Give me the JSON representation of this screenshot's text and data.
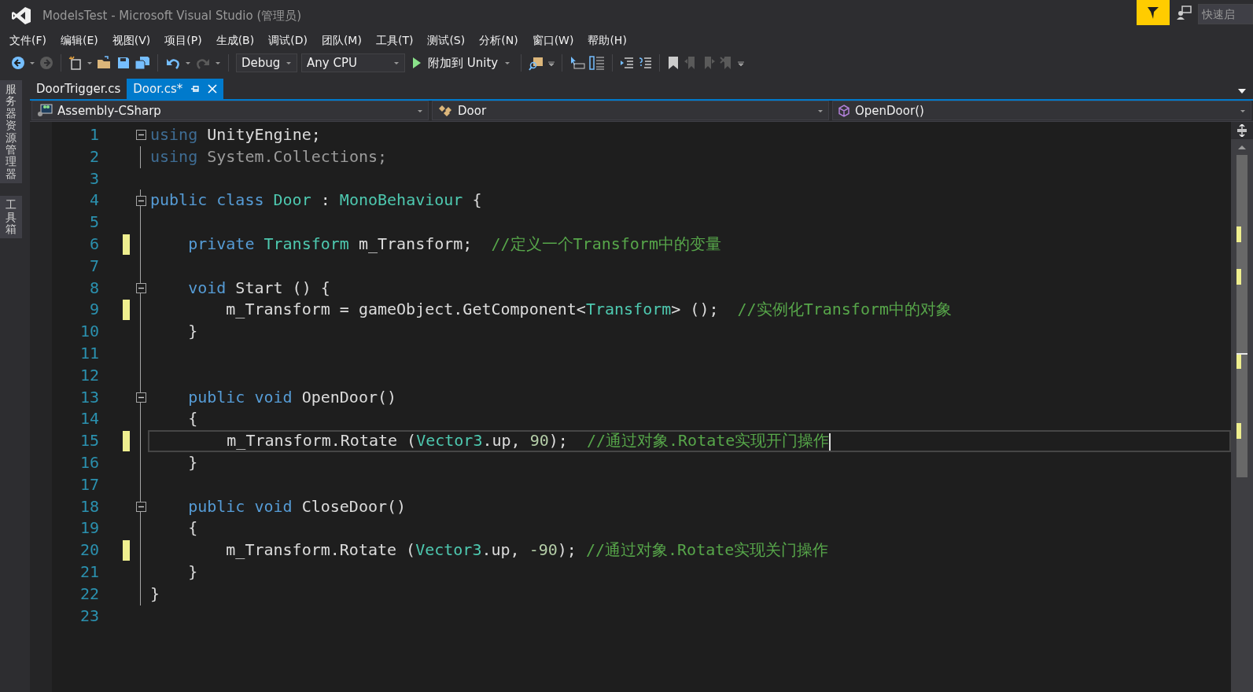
{
  "window": {
    "title": "ModelsTest - Microsoft Visual Studio (管理员)"
  },
  "quick_launch": {
    "placeholder": "快速启"
  },
  "menu": [
    "文件(F)",
    "编辑(E)",
    "视图(V)",
    "项目(P)",
    "生成(B)",
    "调试(D)",
    "团队(M)",
    "工具(T)",
    "测试(S)",
    "分析(N)",
    "窗口(W)",
    "帮助(H)"
  ],
  "toolbar": {
    "configuration": "Debug",
    "platform": "Any CPU",
    "run_label": "附加到 Unity"
  },
  "side_panels": [
    "服务器资源管理器",
    "工具箱"
  ],
  "tabs": [
    {
      "label": "DoorTrigger.cs",
      "selected": false
    },
    {
      "label": "Door.cs*",
      "selected": true
    }
  ],
  "navigation": {
    "project": "Assembly-CSharp",
    "type": "Door",
    "member": "OpenDoor()"
  },
  "editor": {
    "lines": [
      {
        "number": "1",
        "collapsible": true,
        "modified": false,
        "current": false,
        "tokens": [
          {
            "kind": "dim_kw",
            "text": "using"
          },
          {
            "kind": "p",
            "text": " UnityEngine;"
          }
        ]
      },
      {
        "number": "2",
        "collapsible": false,
        "modified": false,
        "current": false,
        "tokens": [
          {
            "kind": "dim_kw",
            "text": "using"
          },
          {
            "kind": "dim",
            "text": " System.Collections;"
          }
        ]
      },
      {
        "number": "3",
        "collapsible": false,
        "modified": false,
        "current": false
      },
      {
        "number": "4",
        "collapsible": true,
        "modified": false,
        "current": false,
        "tokens": [
          {
            "kind": "kw",
            "text": "public class"
          },
          {
            "kind": "type",
            "text": " Door"
          },
          {
            "kind": "p",
            "text": " : "
          },
          {
            "kind": "type",
            "text": "MonoBehaviour"
          },
          {
            "kind": "p",
            "text": " {"
          }
        ]
      },
      {
        "number": "5",
        "collapsible": false,
        "modified": false,
        "current": false
      },
      {
        "number": "6",
        "collapsible": false,
        "modified": true,
        "current": false,
        "tokens": [
          {
            "kind": "kw",
            "text": "    private"
          },
          {
            "kind": "type",
            "text": " Transform"
          },
          {
            "kind": "p",
            "text": " m_Transform;  "
          },
          {
            "kind": "cm",
            "text": "//定义一个Transform中的变量"
          }
        ]
      },
      {
        "number": "7",
        "collapsible": false,
        "modified": false,
        "current": false
      },
      {
        "number": "8",
        "collapsible": true,
        "modified": false,
        "current": false,
        "tokens": [
          {
            "kind": "kw",
            "text": "    void"
          },
          {
            "kind": "p",
            "text": " Start () {"
          }
        ]
      },
      {
        "number": "9",
        "collapsible": false,
        "modified": true,
        "current": false,
        "tokens": [
          {
            "kind": "p",
            "text": "        m_Transform = gameObject.GetComponent<"
          },
          {
            "kind": "type",
            "text": "Transform"
          },
          {
            "kind": "p",
            "text": "> ();  "
          },
          {
            "kind": "cm",
            "text": "//实例化Transform中的对象"
          }
        ]
      },
      {
        "number": "10",
        "collapsible": false,
        "modified": false,
        "current": false,
        "tokens": [
          {
            "kind": "p",
            "text": "    }"
          }
        ]
      },
      {
        "number": "11",
        "collapsible": false,
        "modified": false,
        "current": false
      },
      {
        "number": "12",
        "collapsible": false,
        "modified": false,
        "current": false
      },
      {
        "number": "13",
        "collapsible": true,
        "modified": false,
        "current": false,
        "tokens": [
          {
            "kind": "kw",
            "text": "    public void"
          },
          {
            "kind": "p",
            "text": " OpenDoor()"
          }
        ]
      },
      {
        "number": "14",
        "collapsible": false,
        "modified": false,
        "current": false,
        "tokens": [
          {
            "kind": "p",
            "text": "    {"
          }
        ]
      },
      {
        "number": "15",
        "collapsible": false,
        "modified": true,
        "current": true,
        "tokens": [
          {
            "kind": "p",
            "text": "        m_Transform.Rotate ("
          },
          {
            "kind": "type",
            "text": "Vector3"
          },
          {
            "kind": "p",
            "text": ".up, "
          },
          {
            "kind": "num",
            "text": "90"
          },
          {
            "kind": "p",
            "text": ");  "
          },
          {
            "kind": "cm",
            "text": "//通过对象.Rotate实现开门操作"
          }
        ]
      },
      {
        "number": "16",
        "collapsible": false,
        "modified": false,
        "current": false,
        "tokens": [
          {
            "kind": "p",
            "text": "    }"
          }
        ]
      },
      {
        "number": "17",
        "collapsible": false,
        "modified": false,
        "current": false
      },
      {
        "number": "18",
        "collapsible": true,
        "modified": false,
        "current": false,
        "tokens": [
          {
            "kind": "kw",
            "text": "    public void"
          },
          {
            "kind": "p",
            "text": " CloseDoor()"
          }
        ]
      },
      {
        "number": "19",
        "collapsible": false,
        "modified": false,
        "current": false,
        "tokens": [
          {
            "kind": "p",
            "text": "    {"
          }
        ]
      },
      {
        "number": "20",
        "collapsible": false,
        "modified": true,
        "current": false,
        "tokens": [
          {
            "kind": "p",
            "text": "        m_Transform.Rotate ("
          },
          {
            "kind": "type",
            "text": "Vector3"
          },
          {
            "kind": "p",
            "text": ".up, "
          },
          {
            "kind": "num",
            "text": "-90"
          },
          {
            "kind": "p",
            "text": "); "
          },
          {
            "kind": "cm",
            "text": "//通过对象.Rotate实现关门操作"
          }
        ]
      },
      {
        "number": "21",
        "collapsible": false,
        "modified": false,
        "current": false,
        "tokens": [
          {
            "kind": "p",
            "text": "    }"
          }
        ]
      },
      {
        "number": "22",
        "collapsible": false,
        "modified": false,
        "current": false,
        "tokens": [
          {
            "kind": "p",
            "text": "}"
          }
        ]
      },
      {
        "number": "23",
        "collapsible": false,
        "modified": false,
        "current": false
      }
    ]
  }
}
